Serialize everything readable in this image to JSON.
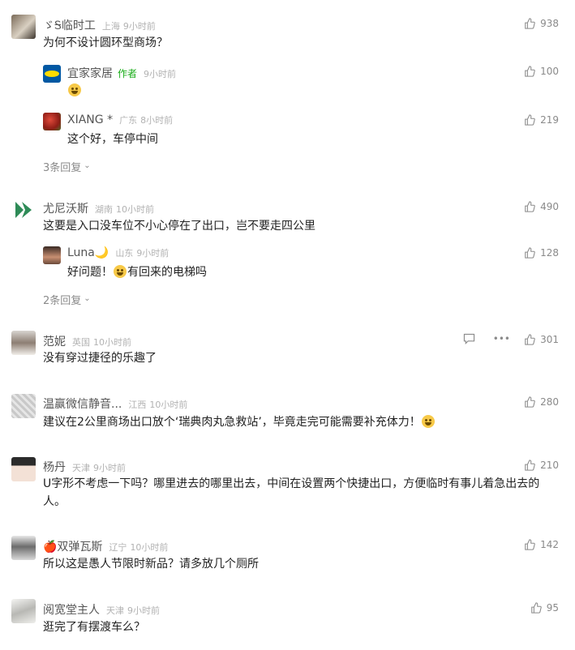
{
  "comments": [
    {
      "name": "ゞᎦ临时工",
      "location": "上海",
      "time": "9小时前",
      "text": "为何不设计圆环型商场？",
      "likes": "938",
      "avatar_icon": "husky-dog-avatar",
      "replies": [
        {
          "name": "宜家家居",
          "tag": "作者",
          "location": "",
          "time": "9小时前",
          "text": "",
          "likes": "100",
          "avatar_icon": "ikea-logo-avatar",
          "emoji": "smile-sweat-emoji"
        },
        {
          "name": "XIANG *",
          "location": "广东",
          "time": "8小时前",
          "text": "这个好，车停中间",
          "likes": "219",
          "avatar_icon": "red-flower-avatar"
        }
      ],
      "more_replies": "3条回复"
    },
    {
      "name": "尤尼沃斯",
      "location": "湖南",
      "time": "10小时前",
      "text": "这要是入口没车位不小心停在了出口，岂不要走四公里",
      "likes": "490",
      "avatar_icon": "green-d-logo-avatar",
      "replies": [
        {
          "name": "Luna🌙",
          "location": "山东",
          "time": "9小时前",
          "text_before": "好问题！",
          "text_after": "有回来的电梯吗",
          "likes": "128",
          "avatar_icon": "portrait-avatar",
          "emoji": "laughing-emoji"
        }
      ],
      "more_replies": "2条回复"
    },
    {
      "name": "范妮",
      "location": "英国",
      "time": "10小时前",
      "text": "没有穿过捷径的乐趣了",
      "likes": "301",
      "avatar_icon": "portrait-avatar",
      "actions": [
        "comment-icon",
        "more-icon"
      ]
    },
    {
      "name": "温赢微信静音...",
      "location": "江西",
      "time": "10小时前",
      "text": "建议在2公里商场出口放个‘瑞典肉丸急救站’，毕竟走完可能需要补充体力！",
      "likes": "280",
      "avatar_icon": "grey-pattern-avatar",
      "emoji": "party-emoji"
    },
    {
      "name": "杨丹",
      "location": "天津",
      "time": "9小时前",
      "text": "U字形不考虑一下吗？哪里进去的哪里出去，中间在设置两个快捷出口，方便临时有事儿着急出去的人。",
      "likes": "210",
      "avatar_icon": "cartoon-girl-avatar"
    },
    {
      "name": "🍎双弹瓦斯",
      "location": "辽宁",
      "time": "10小时前",
      "text": "所以这是愚人节限时新品？请多放几个厕所",
      "likes": "142",
      "avatar_icon": "portrait-avatar"
    },
    {
      "name": "阅宽堂主人",
      "location": "天津",
      "time": "9小时前",
      "text": "逛完了有摆渡车么？",
      "likes": "95",
      "avatar_icon": "ink-painting-avatar"
    }
  ]
}
